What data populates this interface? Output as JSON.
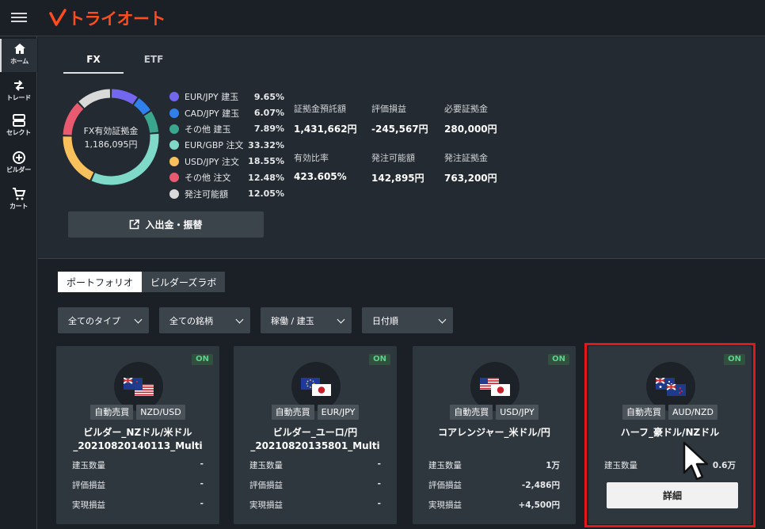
{
  "app": {
    "logo_text": "トライオート"
  },
  "sidebar": {
    "items": [
      {
        "label": "ホーム",
        "icon": "home-icon",
        "active": true
      },
      {
        "label": "トレード",
        "icon": "trade-arrows-icon",
        "active": false
      },
      {
        "label": "セレクト",
        "icon": "select-icon",
        "active": false
      },
      {
        "label": "ビルダー",
        "icon": "builder-plus-icon",
        "active": false
      },
      {
        "label": "カート",
        "icon": "cart-icon",
        "active": false
      }
    ]
  },
  "summary": {
    "tabs": [
      {
        "label": "FX",
        "active": true
      },
      {
        "label": "ETF",
        "active": false
      }
    ],
    "donut_label_1": "FX有効証拠金",
    "donut_label_2": "1,186,095円",
    "legend": [
      {
        "name": "EUR/JPY 建玉",
        "pct": "9.65%",
        "value": 9.65,
        "color": "#7367f0"
      },
      {
        "name": "CAD/JPY 建玉",
        "pct": "6.07%",
        "value": 6.07,
        "color": "#2f80ed"
      },
      {
        "name": "その他 建玉",
        "pct": "7.89%",
        "value": 7.89,
        "color": "#3aa68e"
      },
      {
        "name": "EUR/GBP 注文",
        "pct": "33.32%",
        "value": 33.32,
        "color": "#7ed9c8"
      },
      {
        "name": "USD/JPY 注文",
        "pct": "18.55%",
        "value": 18.55,
        "color": "#f9c15b"
      },
      {
        "name": "その他 注文",
        "pct": "12.48%",
        "value": 12.48,
        "color": "#e85a6f"
      },
      {
        "name": "発注可能額",
        "pct": "12.05%",
        "value": 12.05,
        "color": "#d9d9d9"
      }
    ],
    "stats": [
      {
        "label": "証拠金預託額",
        "value": "1,431,662円"
      },
      {
        "label": "評価損益",
        "value": "-245,567円"
      },
      {
        "label": "必要証拠金",
        "value": "280,000円"
      },
      {
        "label": "有効比率",
        "value": "423.605%"
      },
      {
        "label": "発注可能額",
        "value": "142,895円"
      },
      {
        "label": "発注証拠金",
        "value": "763,200円"
      }
    ],
    "deposit_button": "入出金・振替"
  },
  "portfolio": {
    "tabs": [
      {
        "label": "ポートフォリオ",
        "active": true
      },
      {
        "label": "ビルダーズラボ",
        "active": false
      }
    ],
    "filters": [
      "全てのタイプ",
      "全ての銘柄",
      "稼働 / 建玉",
      "日付順"
    ],
    "cards": [
      {
        "status": "ON",
        "type_tag": "自動売買",
        "pair_tag": "NZD/USD",
        "title_1": "ビルダー_NZドル/米ドル",
        "title_2": "_20210820140113_Multi",
        "flags": [
          "nz",
          "us"
        ],
        "rows": [
          {
            "label": "建玉数量",
            "value": "-"
          },
          {
            "label": "評価損益",
            "value": "-"
          },
          {
            "label": "実現損益",
            "value": "-"
          }
        ]
      },
      {
        "status": "ON",
        "type_tag": "自動売買",
        "pair_tag": "EUR/JPY",
        "title_1": "ビルダー_ユーロ/円",
        "title_2": "_20210820135801_Multi",
        "flags": [
          "eu",
          "jp"
        ],
        "rows": [
          {
            "label": "建玉数量",
            "value": "-"
          },
          {
            "label": "評価損益",
            "value": "-"
          },
          {
            "label": "実現損益",
            "value": "-"
          }
        ]
      },
      {
        "status": "ON",
        "type_tag": "自動売買",
        "pair_tag": "USD/JPY",
        "title_1": "コアレンジャー_米ドル/円",
        "title_2": "",
        "flags": [
          "us",
          "jp"
        ],
        "rows": [
          {
            "label": "建玉数量",
            "value": "1万"
          },
          {
            "label": "評価損益",
            "value": "-2,486円"
          },
          {
            "label": "実現損益",
            "value": "+4,500円"
          }
        ]
      },
      {
        "status": "ON",
        "type_tag": "自動売買",
        "pair_tag": "AUD/NZD",
        "title_1": "ハーフ_豪ドル/NZドル",
        "title_2": "",
        "flags": [
          "au",
          "nz"
        ],
        "rows": [
          {
            "label": "建玉数量",
            "value": "0.6万"
          }
        ],
        "detail_button": "詳細"
      }
    ]
  }
}
